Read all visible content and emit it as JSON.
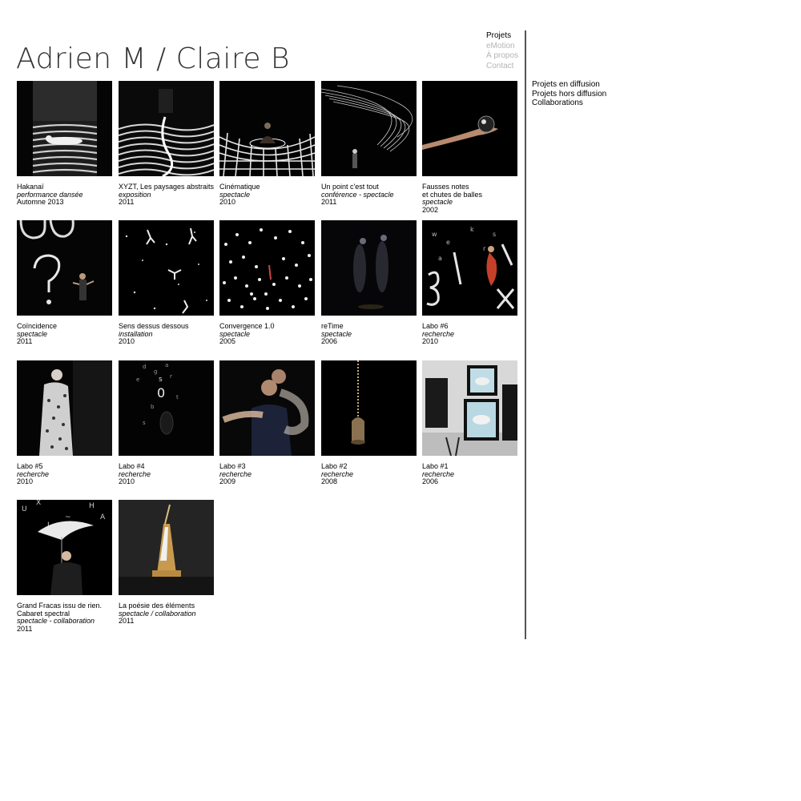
{
  "header": {
    "title": "Adrien M / Claire B"
  },
  "nav": {
    "items": [
      {
        "label": "Projets",
        "active": true
      },
      {
        "label": "eMotion",
        "active": false
      },
      {
        "label": "À propos",
        "active": false
      },
      {
        "label": "Contact",
        "active": false
      }
    ]
  },
  "subnav": {
    "items": [
      {
        "label": "Projets en diffusion"
      },
      {
        "label": "Projets hors diffusion"
      },
      {
        "label": "Collaborations"
      }
    ]
  },
  "projects": [
    {
      "title": "Hakanaï",
      "type": "performance dansée",
      "date": "Automne 2013"
    },
    {
      "title": "XYZT, Les paysages abstraits",
      "type": "exposition",
      "date": "2011"
    },
    {
      "title": "Cinématique",
      "type": "spectacle",
      "date": "2010"
    },
    {
      "title": "Un point c'est tout",
      "type": "conférence - spectacle",
      "date": "2011"
    },
    {
      "title": "Fausses notes",
      "title2": "et chutes de balles",
      "type": "spectacle",
      "date": "2002"
    },
    {
      "title": "Coïncidence",
      "type": "spectacle",
      "date": "2011"
    },
    {
      "title": "Sens dessus dessous",
      "type": "installation",
      "date": "2010"
    },
    {
      "title": "Convergence 1.0",
      "type": "spectacle",
      "date": "2005"
    },
    {
      "title": "reTime",
      "type": "spectacle",
      "date": "2006"
    },
    {
      "title": "Labo #6",
      "type": "recherche",
      "date": "2010"
    },
    {
      "title": "Labo #5",
      "type": "recherche",
      "date": "2010"
    },
    {
      "title": "Labo #4",
      "type": "recherche",
      "date": "2010"
    },
    {
      "title": "Labo #3",
      "type": "recherche",
      "date": "2009"
    },
    {
      "title": "Labo #2",
      "type": "recherche",
      "date": "2008"
    },
    {
      "title": "Labo #1",
      "type": "recherche",
      "date": "2006"
    },
    {
      "title": "Grand Fracas issu de rien.",
      "title2": "Cabaret spectral",
      "type": "spectacle - collaboration",
      "date": "2011"
    },
    {
      "title": "La poésie des éléments",
      "type": "spectacle / collaboration",
      "date": "2011"
    }
  ]
}
